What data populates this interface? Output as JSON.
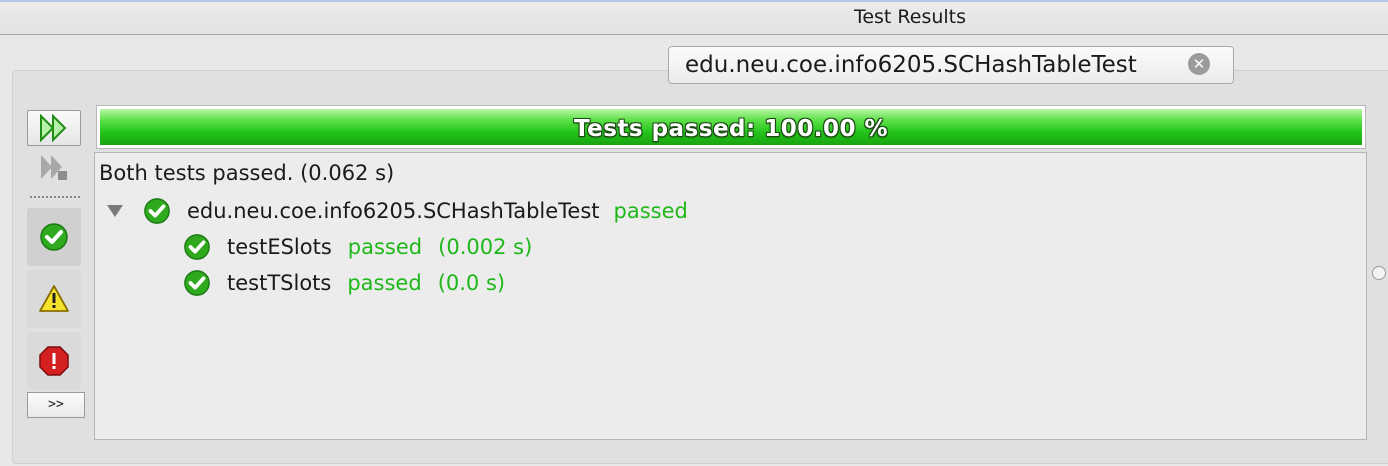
{
  "window": {
    "title": "Test Results"
  },
  "tab": {
    "label": "edu.neu.coe.info6205.SCHashTableTest"
  },
  "toolbar": {
    "more_label": ">>",
    "icons": [
      "rerun-icon",
      "rerun-failed-icon",
      "filter-passed-icon",
      "filter-warning-icon",
      "filter-error-icon"
    ]
  },
  "progress": {
    "label": "Tests passed: 100.00 %",
    "fraction": 1.0,
    "color": "#23c41a"
  },
  "results": {
    "summary": "Both tests passed. (0.062 s)",
    "suite": {
      "name": "edu.neu.coe.info6205.SCHashTableTest",
      "status": "passed"
    },
    "tests": [
      {
        "name": "testESlots",
        "status": "passed",
        "time": "(0.002 s)"
      },
      {
        "name": "testTSlots",
        "status": "passed",
        "time": "(0.0 s)"
      }
    ]
  },
  "colors": {
    "passed_text": "#1fb81a",
    "check_green": "#2faa1e"
  }
}
